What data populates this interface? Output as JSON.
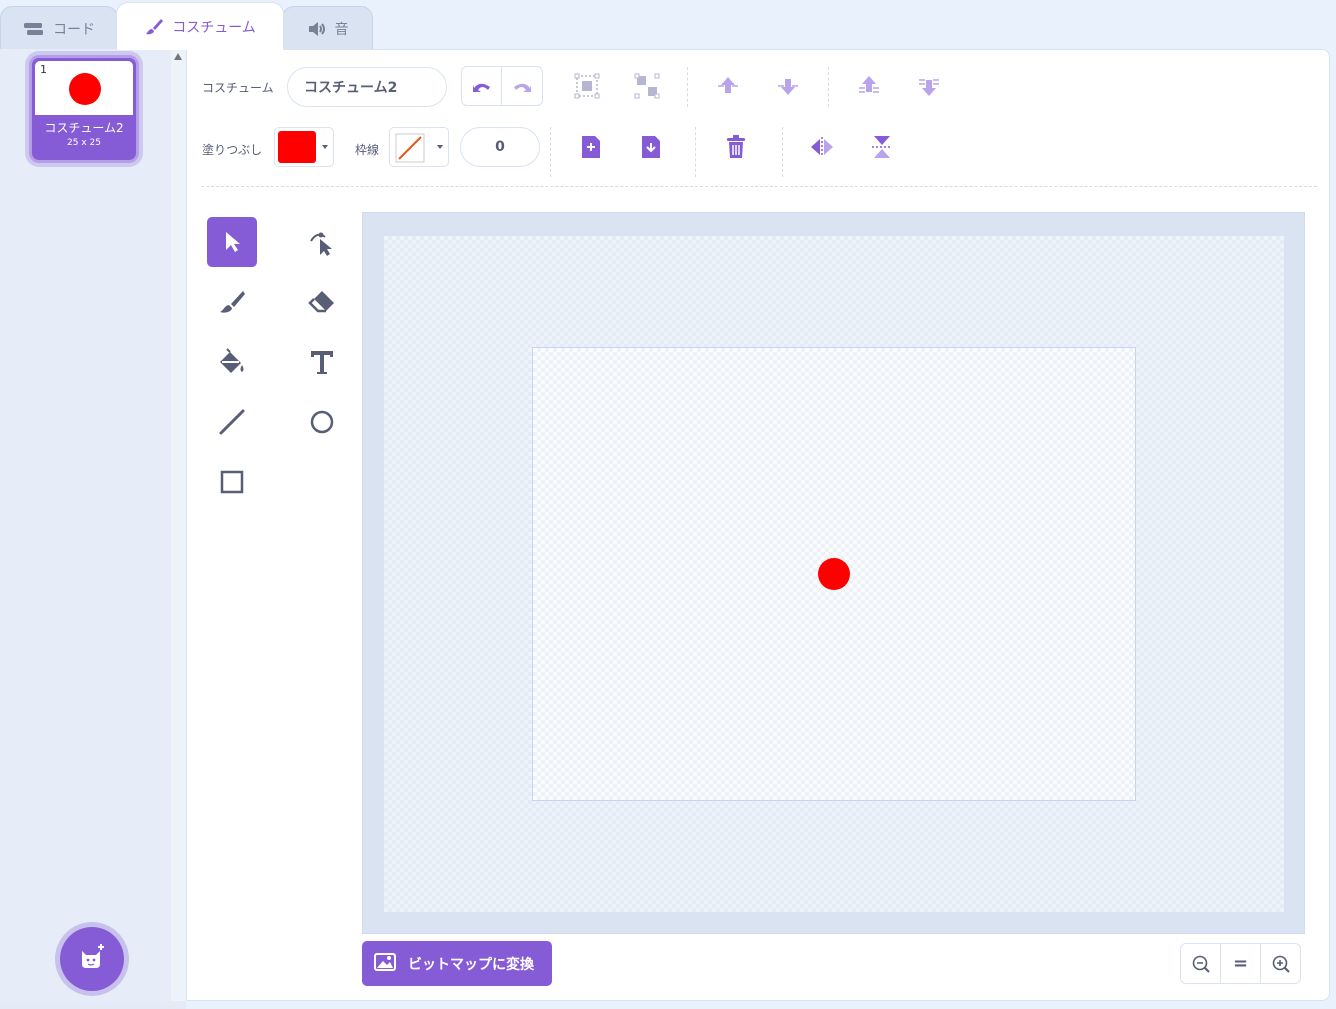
{
  "tabs": {
    "code": "コード",
    "costume": "コスチューム",
    "sound": "音"
  },
  "costumes": [
    {
      "index": "1",
      "name": "コスチューム2",
      "size": "25 x 25"
    }
  ],
  "toolbar": {
    "costume_label": "コスチューム",
    "costume_name_value": "コスチューム2",
    "fill_label": "塗りつぶし",
    "fill_color": "#ff0000",
    "outline_label": "枠線",
    "outline_width": "0"
  },
  "convert_button": "ビットマップに変換",
  "zoom_reset": "=",
  "colors": {
    "accent": "#855cd6",
    "fill": "#ff0000"
  }
}
